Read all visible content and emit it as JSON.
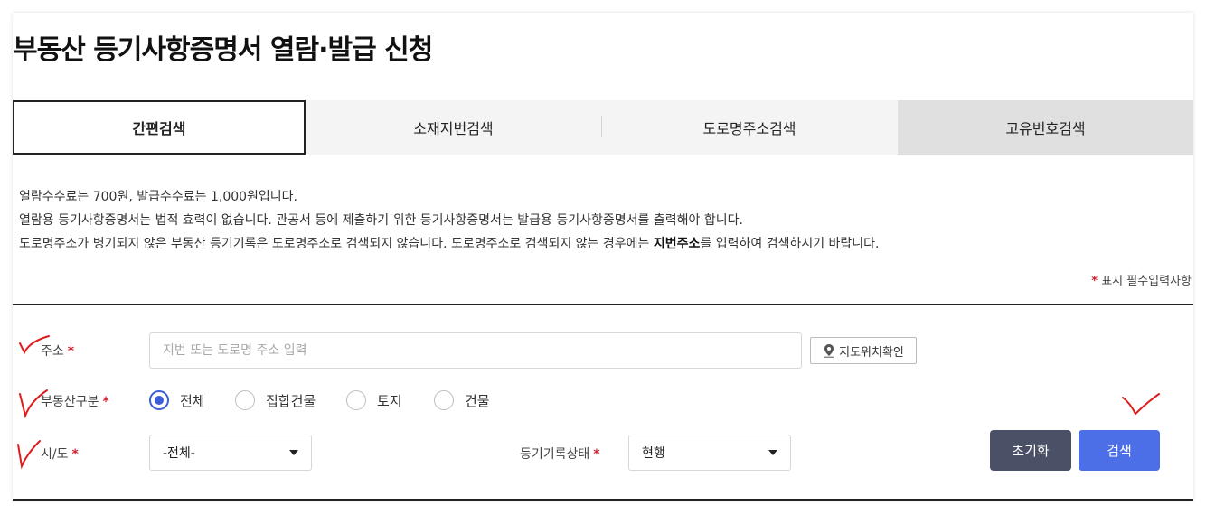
{
  "page": {
    "title": "부동산 등기사항증명서 열람·발급 신청"
  },
  "tabs": [
    {
      "label": "간편검색",
      "active": true
    },
    {
      "label": "소재지번검색",
      "active": false
    },
    {
      "label": "도로명주소검색",
      "active": false
    },
    {
      "label": "고유번호검색",
      "active": false
    }
  ],
  "notices": {
    "line1": "열람수수료는  700원, 발급수수료는  1,000원입니다.",
    "line2": "열람용 등기사항증명서는 법적 효력이 없습니다. 관공서 등에 제출하기 위한 등기사항증명서는 발급용 등기사항증명서를 출력해야 합니다.",
    "line3_before": "도로명주소가 병기되지 않은 부동산 등기기록은 도로명주소로 검색되지 않습니다. 도로명주소로 검색되지 않는 경우에는 ",
    "line3_bold": "지번주소",
    "line3_after": "를 입력하여 검색하시기 바랍니다."
  },
  "required_note": {
    "mark": "*",
    "text": "표시 필수입력사항"
  },
  "form": {
    "required_mark": "*",
    "address": {
      "label": "주소",
      "placeholder": "지번 또는 도로명 주소 입력",
      "value": ""
    },
    "map_button": {
      "icon": "map-pin-icon",
      "label": "지도위치확인"
    },
    "property_type": {
      "label": "부동산구분",
      "options": [
        "전체",
        "집합건물",
        "토지",
        "건물"
      ],
      "selected": "전체"
    },
    "region": {
      "label": "시/도",
      "selected": "-전체-"
    },
    "record_status": {
      "label": "등기기록상태",
      "selected": "현행"
    },
    "buttons": {
      "reset": "초기화",
      "search": "검색"
    }
  },
  "colors": {
    "accent": "#4c6ee6",
    "reset_button": "#4a5166",
    "required": "#d01f2f",
    "annotation": "#e01b1b"
  }
}
